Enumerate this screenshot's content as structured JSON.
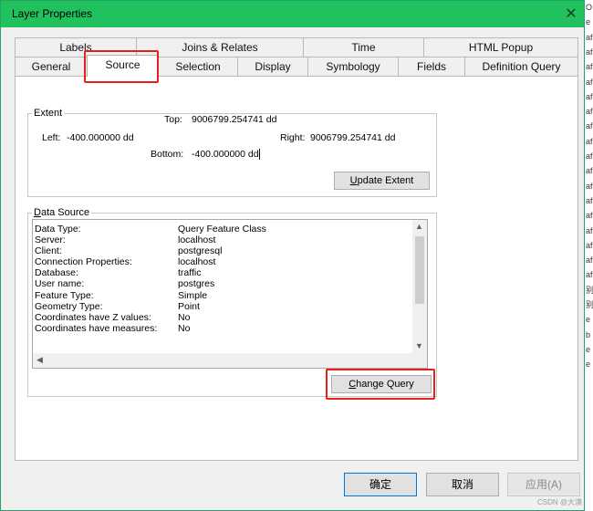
{
  "window": {
    "title": "Layer Properties",
    "close_glyph": "✕"
  },
  "tabs_row1": [
    "Labels",
    "Joins & Relates",
    "Time",
    "HTML Popup"
  ],
  "tabs_row2": [
    "General",
    "Source",
    "Selection",
    "Display",
    "Symbology",
    "Fields",
    "Definition Query"
  ],
  "extent": {
    "label": "Extent",
    "top_label": "Top:",
    "top_value": "9006799.254741 dd",
    "left_label": "Left:",
    "left_value": "-400.000000 dd",
    "right_label": "Right:",
    "right_value": "9006799.254741 dd",
    "bottom_label": "Bottom:",
    "bottom_value": "-400.000000 dd",
    "update_button_u": "U",
    "update_button_rest": "pdate Extent"
  },
  "data_source": {
    "label_u": "D",
    "label_rest": "ata Source",
    "rows": [
      {
        "k": "Data Type:",
        "v": "Query Feature Class"
      },
      {
        "k": "Server:",
        "v": "localhost"
      },
      {
        "k": "Client:",
        "v": "postgresql"
      },
      {
        "k": "Connection Properties:",
        "v": "localhost"
      },
      {
        "k": "Database:",
        "v": "traffic"
      },
      {
        "k": "User name:",
        "v": "postgres"
      },
      {
        "k": "Feature Type:",
        "v": "Simple"
      },
      {
        "k": "Geometry Type:",
        "v": "Point"
      },
      {
        "k": "Coordinates have Z values:",
        "v": "No"
      },
      {
        "k": "Coordinates have measures:",
        "v": "No"
      }
    ],
    "change_button_u": "C",
    "change_button_rest": "hange Query"
  },
  "footer": {
    "ok": "确定",
    "cancel": "取消",
    "apply": "应用(A)"
  },
  "right_strip": [
    "O",
    "e",
    "af",
    "af",
    "af",
    "af",
    "af",
    "af",
    "af",
    "af",
    "af",
    "af",
    "af",
    "af",
    "af",
    "af",
    "af",
    "af",
    "af",
    "别",
    "别",
    "e",
    "b",
    "e",
    "e"
  ],
  "watermark": "CSDN @大漠"
}
